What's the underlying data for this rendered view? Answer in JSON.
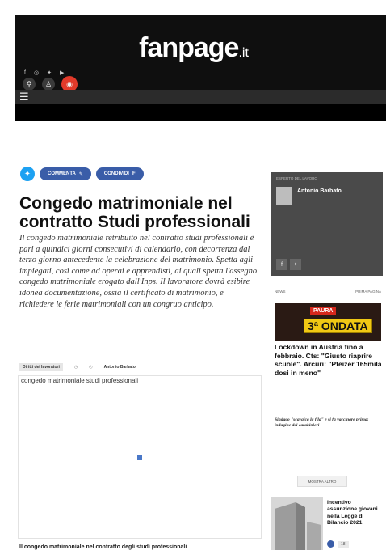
{
  "header": {
    "brand": "fanpage",
    "brand_tld": ".it"
  },
  "share": {
    "comment_label": "Commenta",
    "share_label": "Condividi"
  },
  "article": {
    "title": "Congedo matrimoniale nel contratto Studi professionali",
    "subtitle": "Il congedo matrimoniale retribuito nel contratto studi professionali è pari a quindici giorni consecutivi di calendario, con decorrenza dal terzo giorno antecedente la celebrazione del matrimonio. Spetta agli impiegati, così come ad operai e apprendisti, ai quali spetta l'assegno congedo matrimoniale erogato dall'Inps. Il lavoratore dovrà esibire idonea documentazione, ossia il certificato di matrimonio, e richiedere le ferie matrimoniali con un congruo anticipo.",
    "category": "Diritti dei lavoratori",
    "author_meta": "Antonio Barbato",
    "image_caption": "congedo matrimoniale studi professionali",
    "bottom_caption": "Il congedo matrimoniale nel contratto degli studi professionali"
  },
  "author_box": {
    "label": "Esperto del lavoro",
    "name": "Antonio Barbato"
  },
  "news": {
    "left_label": "News",
    "right_label": "Prima pagina",
    "image_badge_top": "PAURA",
    "image_badge_main": "3ª ONDATA",
    "headline": "Lockdown in Austria fino a febbraio. Cts: \"Giusto riaprire scuole\". Arcuri: \"Pfeizer 165mila dosi in meno\"",
    "item2": "Sindaco \"scavalca la fila\" e si fa vaccinare prima: indagine dei carabinieri",
    "more_button": "Mostra altro"
  },
  "promo": {
    "title": "Incentivo assunzione giovani nella Legge di Bilancio 2021",
    "count": "18"
  },
  "colors": {
    "brand_red": "#e23a2a",
    "social_blue": "#3a5da8",
    "twitter": "#1da1f2",
    "ondata_yellow": "#f0c814"
  }
}
